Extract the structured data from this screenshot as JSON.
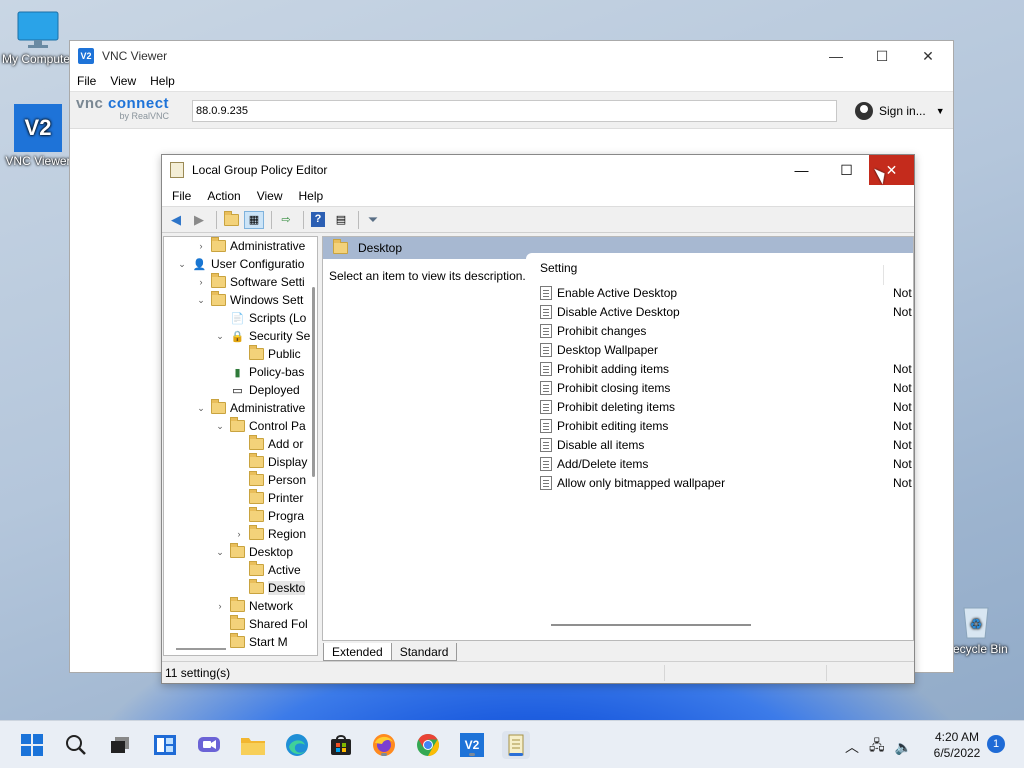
{
  "desktop": {
    "icons": [
      {
        "label": "My Computer",
        "icon": "monitor-icon"
      },
      {
        "label": "VNC Viewer",
        "icon": "vnc-app-icon"
      },
      {
        "label": "Recycle Bin",
        "icon": "recycle-bin-icon"
      }
    ]
  },
  "vnc": {
    "title": "VNC Viewer",
    "logo_text": "V2",
    "menu": [
      "File",
      "View",
      "Help"
    ],
    "brand_main": "VNC CONNECT",
    "brand_main_a": "vnc ",
    "brand_main_b": "connect",
    "brand_sub": "by RealVNC",
    "address": "88.0.9.235",
    "sign_in": "Sign in...",
    "controls": {
      "minimize": "—",
      "maximize": "☐",
      "close": "✕"
    }
  },
  "gpe": {
    "title": "Local Group Policy Editor",
    "menu": [
      "File",
      "Action",
      "View",
      "Help"
    ],
    "controls": {
      "minimize": "—",
      "maximize": "☐",
      "close": "✕"
    },
    "tree": [
      {
        "label": "Administrative",
        "indent": 1,
        "expander": "›",
        "icon": "folder-icon"
      },
      {
        "label": "User Configuratio",
        "indent": 0,
        "expander": "⌄",
        "icon": "user-config-icon"
      },
      {
        "label": "Software Setti",
        "indent": 1,
        "expander": "›",
        "icon": "folder-icon"
      },
      {
        "label": "Windows Sett",
        "indent": 1,
        "expander": "⌄",
        "icon": "folder-icon"
      },
      {
        "label": "Scripts (Lo",
        "indent": 2,
        "expander": "",
        "icon": "scripts-icon"
      },
      {
        "label": "Security Se",
        "indent": 2,
        "expander": "⌄",
        "icon": "security-icon"
      },
      {
        "label": "Public",
        "indent": 3,
        "expander": "",
        "icon": "folder-icon"
      },
      {
        "label": "Policy-bas",
        "indent": 2,
        "expander": "",
        "icon": "chart-icon"
      },
      {
        "label": "Deployed",
        "indent": 2,
        "expander": "",
        "icon": "printer-icon"
      },
      {
        "label": "Administrative",
        "indent": 1,
        "expander": "⌄",
        "icon": "folder-icon"
      },
      {
        "label": "Control Pa",
        "indent": 2,
        "expander": "⌄",
        "icon": "folder-icon"
      },
      {
        "label": "Add or",
        "indent": 3,
        "expander": "",
        "icon": "folder-icon"
      },
      {
        "label": "Display",
        "indent": 3,
        "expander": "",
        "icon": "folder-icon"
      },
      {
        "label": "Person",
        "indent": 3,
        "expander": "",
        "icon": "folder-icon"
      },
      {
        "label": "Printer",
        "indent": 3,
        "expander": "",
        "icon": "folder-icon"
      },
      {
        "label": "Progra",
        "indent": 3,
        "expander": "",
        "icon": "folder-icon"
      },
      {
        "label": "Region",
        "indent": 3,
        "expander": "›",
        "icon": "folder-icon"
      },
      {
        "label": "Desktop",
        "indent": 2,
        "expander": "⌄",
        "icon": "folder-icon"
      },
      {
        "label": "Active",
        "indent": 3,
        "expander": "",
        "icon": "folder-icon"
      },
      {
        "label": "Deskto",
        "indent": 3,
        "expander": "",
        "icon": "folder-icon",
        "selected": true
      },
      {
        "label": "Network",
        "indent": 2,
        "expander": "›",
        "icon": "folder-icon"
      },
      {
        "label": "Shared Fol",
        "indent": 2,
        "expander": "",
        "icon": "folder-icon"
      },
      {
        "label": "Start M",
        "indent": 2,
        "expander": "",
        "icon": "folder-icon"
      }
    ],
    "right_header": "Desktop",
    "description": "Select an item to view its description.",
    "column_setting": "Setting",
    "settings": [
      {
        "name": "Enable Active Desktop",
        "state": "Not"
      },
      {
        "name": "Disable Active Desktop",
        "state": "Not"
      },
      {
        "name": "Prohibit changes",
        "state": ""
      },
      {
        "name": "Desktop Wallpaper",
        "state": ""
      },
      {
        "name": "Prohibit adding items",
        "state": "Not"
      },
      {
        "name": "Prohibit closing items",
        "state": "Not"
      },
      {
        "name": "Prohibit deleting items",
        "state": "Not"
      },
      {
        "name": "Prohibit editing items",
        "state": "Not"
      },
      {
        "name": "Disable all items",
        "state": "Not"
      },
      {
        "name": "Add/Delete items",
        "state": "Not"
      },
      {
        "name": "Allow only bitmapped wallpaper",
        "state": "Not"
      }
    ],
    "tabs": [
      "Extended",
      "Standard"
    ],
    "status": "11 setting(s)"
  },
  "taskbar": {
    "time": "4:20 AM",
    "date": "6/5/2022",
    "notifications": "1",
    "colors": {
      "accent": "#1f6bd6"
    }
  }
}
